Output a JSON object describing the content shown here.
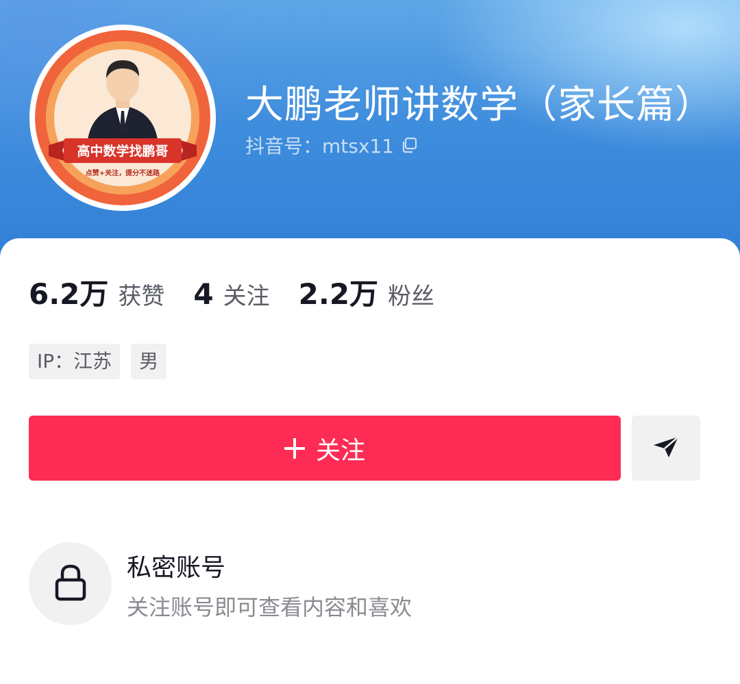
{
  "profile": {
    "name": "大鹏老师讲数学（家长篇）",
    "douyin_id": "抖音号：mtsx11",
    "avatar": {
      "banner_text": "高中数学找鹏哥",
      "sub_text": "点赞+关注，提分不迷路"
    }
  },
  "stats": [
    {
      "value": "6.2万",
      "label": "获赞"
    },
    {
      "value": "4",
      "label": "关注"
    },
    {
      "value": "2.2万",
      "label": "粉丝"
    }
  ],
  "tags": [
    "IP：江苏",
    "男"
  ],
  "actions": {
    "follow_label": "关注",
    "share_icon": "send-icon"
  },
  "private_notice": {
    "title": "私密账号",
    "description": "关注账号即可查看内容和喜欢"
  },
  "colors": {
    "accent": "#fe2c55",
    "header": "#3f8ddd"
  }
}
